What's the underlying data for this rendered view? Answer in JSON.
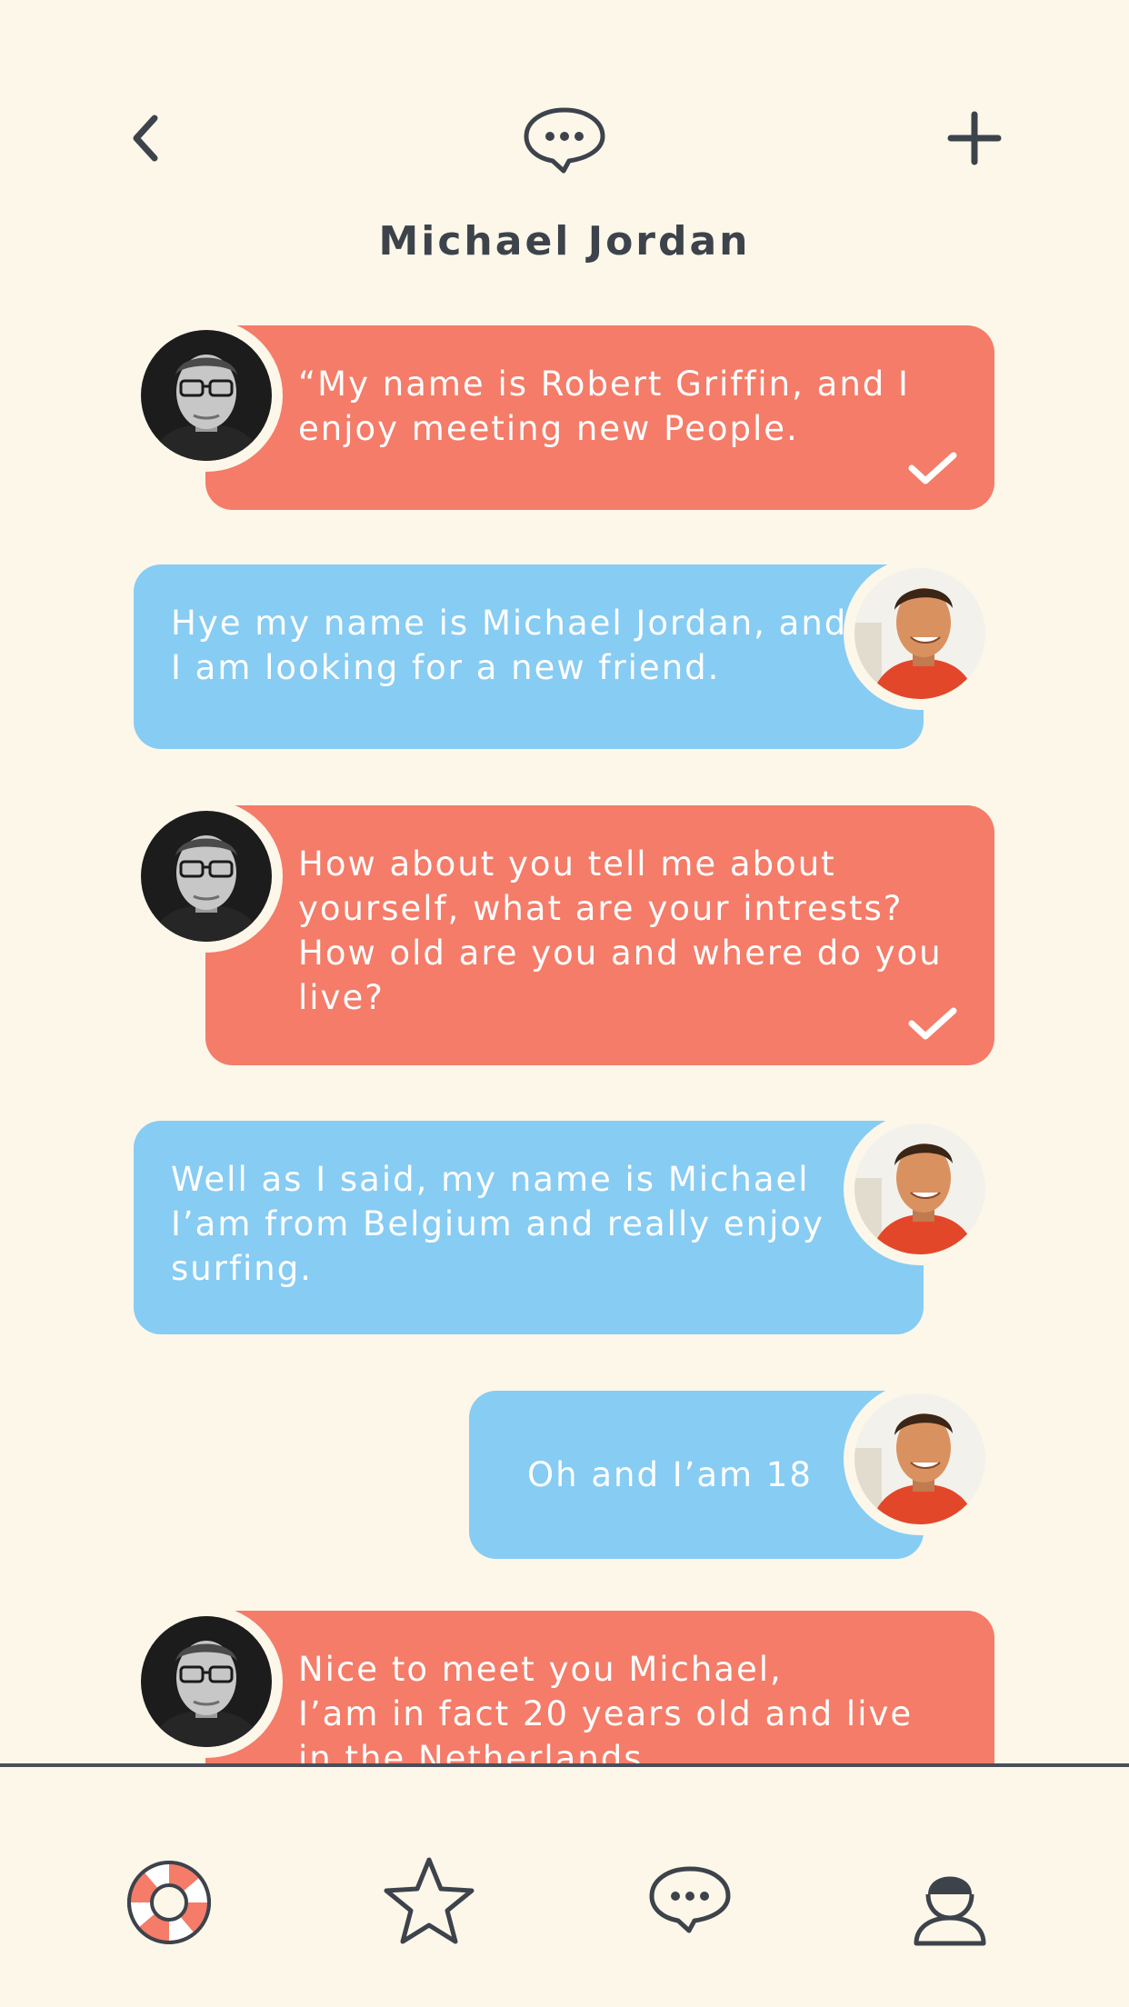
{
  "header": {
    "title": "Michael Jordan",
    "back_icon": "chevron-left-icon",
    "center_icon": "chat-bubble-icon",
    "add_icon": "plus-icon"
  },
  "colors": {
    "background": "#fdf7ea",
    "sent_bubble": "#f47c69",
    "received_bubble": "#87ccf3",
    "text_dark": "#3d434b"
  },
  "messages": [
    {
      "side": "left",
      "color": "red",
      "lines": [
        "“My name is Robert Griffin, and I",
        "enjoy meeting new People."
      ],
      "read": true
    },
    {
      "side": "right",
      "color": "blue",
      "lines": [
        "Hye my name is Michael Jordan, and",
        "I am looking for a new friend."
      ],
      "read": false
    },
    {
      "side": "left",
      "color": "red",
      "lines": [
        "How about you tell me about",
        "yourself, what are your intrests?",
        "How old are you and where do you",
        "live?"
      ],
      "read": true
    },
    {
      "side": "right",
      "color": "blue",
      "lines": [
        "Well as I said, my name is Michael",
        "I’am from Belgium and really enjoy",
        "surfing."
      ],
      "read": false
    },
    {
      "side": "right",
      "color": "blue",
      "lines": [
        "Oh and I’am 18"
      ],
      "read": false
    },
    {
      "side": "left",
      "color": "red",
      "lines": [
        "Nice to meet you Michael,",
        "I’am in fact 20 years old and live",
        "in the Netherlands."
      ],
      "read": false
    }
  ],
  "tabbar": {
    "items": [
      {
        "icon": "lifebuoy-icon",
        "active": true
      },
      {
        "icon": "star-icon",
        "active": false
      },
      {
        "icon": "chat-bubble-icon",
        "active": false
      },
      {
        "icon": "user-icon",
        "active": false
      }
    ]
  }
}
